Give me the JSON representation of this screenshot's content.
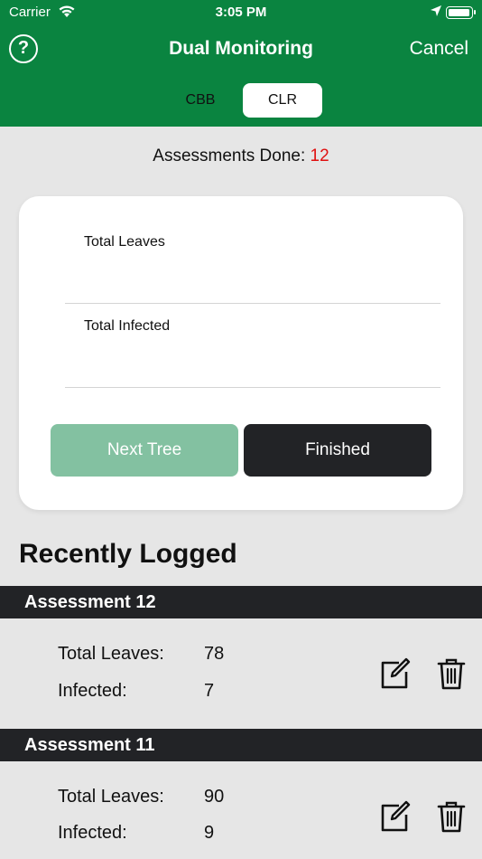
{
  "status_bar": {
    "carrier": "Carrier",
    "time": "3:05 PM"
  },
  "header": {
    "title": "Dual Monitoring",
    "cancel_label": "Cancel",
    "help_label": "?"
  },
  "segments": {
    "items": [
      "CBB",
      "CLR"
    ],
    "selected": "CLR"
  },
  "assessments": {
    "label": "Assessments Done: ",
    "count": "12"
  },
  "form": {
    "total_leaves_placeholder": "Total Leaves",
    "total_infected_placeholder": "Total Infected",
    "next_tree_label": "Next Tree",
    "finished_label": "Finished"
  },
  "recent": {
    "heading": "Recently Logged",
    "entries": [
      {
        "title": "Assessment 12",
        "leaves_label": "Total Leaves:",
        "leaves": "78",
        "infected_label": "Infected:",
        "infected": "7"
      },
      {
        "title": "Assessment 11",
        "leaves_label": "Total Leaves:",
        "leaves": "90",
        "infected_label": "Infected:",
        "infected": "9"
      }
    ]
  },
  "colors": {
    "header_green": "#0a8440",
    "accent_red": "#e01010",
    "disabled_green": "#83c1a1",
    "dark": "#222326"
  },
  "icons": [
    "wifi-icon",
    "location-arrow-icon",
    "battery-icon",
    "help-icon",
    "edit-icon",
    "trash-icon"
  ]
}
